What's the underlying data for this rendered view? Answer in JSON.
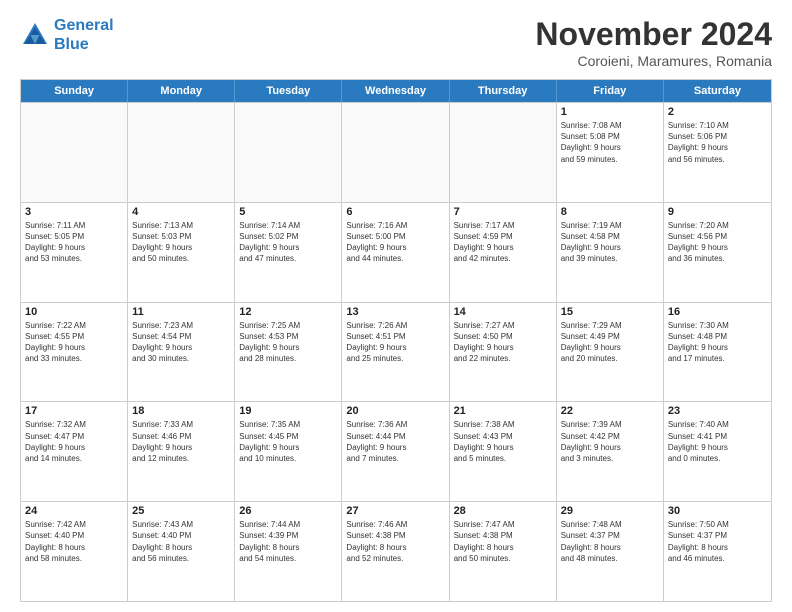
{
  "logo": {
    "line1": "General",
    "line2": "Blue"
  },
  "header": {
    "month": "November 2024",
    "location": "Coroieni, Maramures, Romania"
  },
  "weekdays": [
    "Sunday",
    "Monday",
    "Tuesday",
    "Wednesday",
    "Thursday",
    "Friday",
    "Saturday"
  ],
  "rows": [
    [
      {
        "day": "",
        "info": "",
        "empty": true
      },
      {
        "day": "",
        "info": "",
        "empty": true
      },
      {
        "day": "",
        "info": "",
        "empty": true
      },
      {
        "day": "",
        "info": "",
        "empty": true
      },
      {
        "day": "",
        "info": "",
        "empty": true
      },
      {
        "day": "1",
        "info": "Sunrise: 7:08 AM\nSunset: 5:08 PM\nDaylight: 9 hours\nand 59 minutes."
      },
      {
        "day": "2",
        "info": "Sunrise: 7:10 AM\nSunset: 5:06 PM\nDaylight: 9 hours\nand 56 minutes."
      }
    ],
    [
      {
        "day": "3",
        "info": "Sunrise: 7:11 AM\nSunset: 5:05 PM\nDaylight: 9 hours\nand 53 minutes."
      },
      {
        "day": "4",
        "info": "Sunrise: 7:13 AM\nSunset: 5:03 PM\nDaylight: 9 hours\nand 50 minutes."
      },
      {
        "day": "5",
        "info": "Sunrise: 7:14 AM\nSunset: 5:02 PM\nDaylight: 9 hours\nand 47 minutes."
      },
      {
        "day": "6",
        "info": "Sunrise: 7:16 AM\nSunset: 5:00 PM\nDaylight: 9 hours\nand 44 minutes."
      },
      {
        "day": "7",
        "info": "Sunrise: 7:17 AM\nSunset: 4:59 PM\nDaylight: 9 hours\nand 42 minutes."
      },
      {
        "day": "8",
        "info": "Sunrise: 7:19 AM\nSunset: 4:58 PM\nDaylight: 9 hours\nand 39 minutes."
      },
      {
        "day": "9",
        "info": "Sunrise: 7:20 AM\nSunset: 4:56 PM\nDaylight: 9 hours\nand 36 minutes."
      }
    ],
    [
      {
        "day": "10",
        "info": "Sunrise: 7:22 AM\nSunset: 4:55 PM\nDaylight: 9 hours\nand 33 minutes."
      },
      {
        "day": "11",
        "info": "Sunrise: 7:23 AM\nSunset: 4:54 PM\nDaylight: 9 hours\nand 30 minutes."
      },
      {
        "day": "12",
        "info": "Sunrise: 7:25 AM\nSunset: 4:53 PM\nDaylight: 9 hours\nand 28 minutes."
      },
      {
        "day": "13",
        "info": "Sunrise: 7:26 AM\nSunset: 4:51 PM\nDaylight: 9 hours\nand 25 minutes."
      },
      {
        "day": "14",
        "info": "Sunrise: 7:27 AM\nSunset: 4:50 PM\nDaylight: 9 hours\nand 22 minutes."
      },
      {
        "day": "15",
        "info": "Sunrise: 7:29 AM\nSunset: 4:49 PM\nDaylight: 9 hours\nand 20 minutes."
      },
      {
        "day": "16",
        "info": "Sunrise: 7:30 AM\nSunset: 4:48 PM\nDaylight: 9 hours\nand 17 minutes."
      }
    ],
    [
      {
        "day": "17",
        "info": "Sunrise: 7:32 AM\nSunset: 4:47 PM\nDaylight: 9 hours\nand 14 minutes."
      },
      {
        "day": "18",
        "info": "Sunrise: 7:33 AM\nSunset: 4:46 PM\nDaylight: 9 hours\nand 12 minutes."
      },
      {
        "day": "19",
        "info": "Sunrise: 7:35 AM\nSunset: 4:45 PM\nDaylight: 9 hours\nand 10 minutes."
      },
      {
        "day": "20",
        "info": "Sunrise: 7:36 AM\nSunset: 4:44 PM\nDaylight: 9 hours\nand 7 minutes."
      },
      {
        "day": "21",
        "info": "Sunrise: 7:38 AM\nSunset: 4:43 PM\nDaylight: 9 hours\nand 5 minutes."
      },
      {
        "day": "22",
        "info": "Sunrise: 7:39 AM\nSunset: 4:42 PM\nDaylight: 9 hours\nand 3 minutes."
      },
      {
        "day": "23",
        "info": "Sunrise: 7:40 AM\nSunset: 4:41 PM\nDaylight: 9 hours\nand 0 minutes."
      }
    ],
    [
      {
        "day": "24",
        "info": "Sunrise: 7:42 AM\nSunset: 4:40 PM\nDaylight: 8 hours\nand 58 minutes."
      },
      {
        "day": "25",
        "info": "Sunrise: 7:43 AM\nSunset: 4:40 PM\nDaylight: 8 hours\nand 56 minutes."
      },
      {
        "day": "26",
        "info": "Sunrise: 7:44 AM\nSunset: 4:39 PM\nDaylight: 8 hours\nand 54 minutes."
      },
      {
        "day": "27",
        "info": "Sunrise: 7:46 AM\nSunset: 4:38 PM\nDaylight: 8 hours\nand 52 minutes."
      },
      {
        "day": "28",
        "info": "Sunrise: 7:47 AM\nSunset: 4:38 PM\nDaylight: 8 hours\nand 50 minutes."
      },
      {
        "day": "29",
        "info": "Sunrise: 7:48 AM\nSunset: 4:37 PM\nDaylight: 8 hours\nand 48 minutes."
      },
      {
        "day": "30",
        "info": "Sunrise: 7:50 AM\nSunset: 4:37 PM\nDaylight: 8 hours\nand 46 minutes."
      }
    ]
  ]
}
